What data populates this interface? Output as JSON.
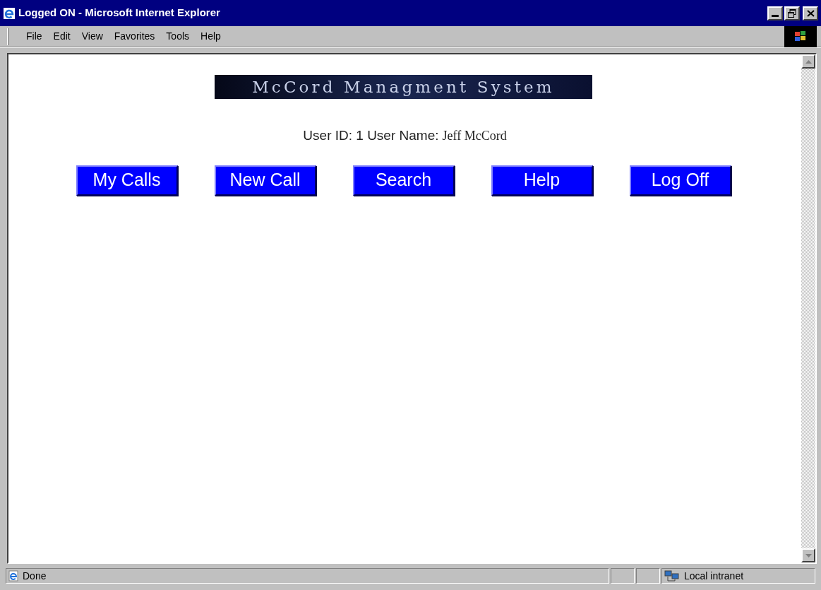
{
  "window": {
    "title": "Logged ON - Microsoft Internet Explorer"
  },
  "menu": [
    "File",
    "Edit",
    "View",
    "Favorites",
    "Tools",
    "Help"
  ],
  "page": {
    "logo": "McCord Managment System",
    "user_line": "User ID: 1 User Name:",
    "user_name": "Jeff McCord",
    "buttons": [
      "My Calls",
      "New Call",
      "Search",
      "Help",
      "Log Off"
    ]
  },
  "status_bar": {
    "text": "Done",
    "zone": "Local intranet"
  }
}
